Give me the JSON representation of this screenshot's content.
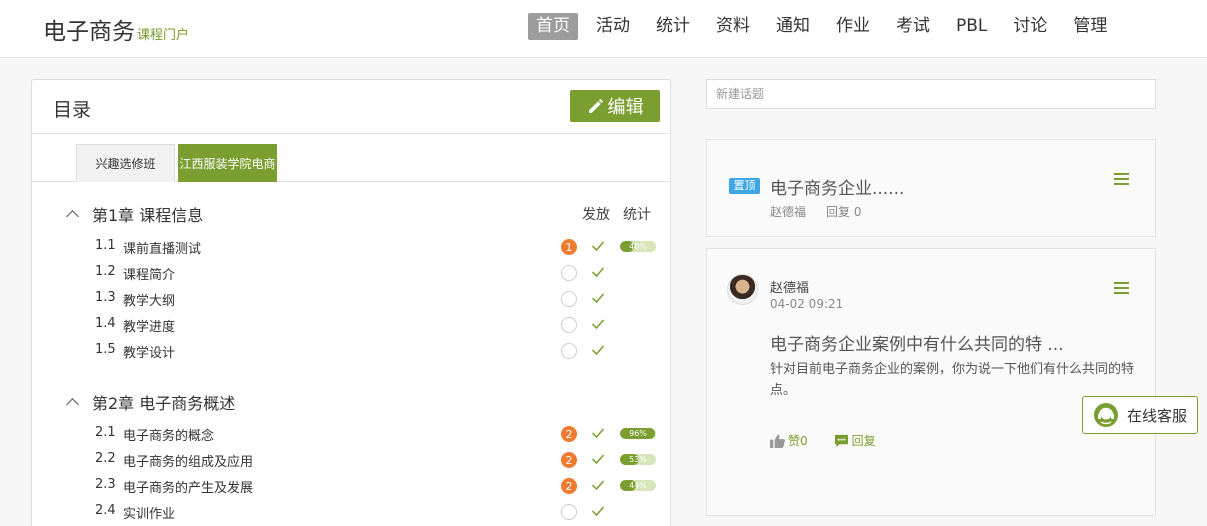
{
  "brand": {
    "title": "电子商务",
    "subtitle": "课程门户"
  },
  "nav": [
    "首页",
    "活动",
    "统计",
    "资料",
    "通知",
    "作业",
    "考试",
    "PBL",
    "讨论",
    "管理"
  ],
  "catalog": {
    "title": "目录",
    "edit_label": "编辑",
    "tabs": [
      "兴趣选修班",
      "江西服装学院电商"
    ],
    "col_publish": "发放",
    "col_stats": "统计",
    "chapters": [
      {
        "title": "第1章 课程信息",
        "items": [
          {
            "num": "1.1",
            "label": "课前直播测试",
            "badge": "1",
            "progress": "40%"
          },
          {
            "num": "1.2",
            "label": "课程简介",
            "badge": "",
            "progress": ""
          },
          {
            "num": "1.3",
            "label": "教学大纲",
            "badge": "",
            "progress": ""
          },
          {
            "num": "1.4",
            "label": "教学进度",
            "badge": "",
            "progress": ""
          },
          {
            "num": "1.5",
            "label": "教学设计",
            "badge": "",
            "progress": ""
          }
        ]
      },
      {
        "title": "第2章 电子商务概述",
        "items": [
          {
            "num": "2.1",
            "label": "电子商务的概念",
            "badge": "2",
            "progress": "96%"
          },
          {
            "num": "2.2",
            "label": "电子商务的组成及应用",
            "badge": "2",
            "progress": "53%"
          },
          {
            "num": "2.3",
            "label": "电子商务的产生及发展",
            "badge": "2",
            "progress": "44%"
          },
          {
            "num": "2.4",
            "label": "实训作业",
            "badge": "",
            "progress": ""
          }
        ]
      }
    ]
  },
  "discussion": {
    "new_topic_placeholder": "新建话题",
    "pinned": {
      "tag": "置顶",
      "title": "电子商务企业......",
      "author": "赵德福",
      "reply": "回复 0"
    },
    "post": {
      "author": "赵德福",
      "time": "04-02 09:21",
      "title": "电子商务企业案例中有什么共同的特 ...",
      "body": "针对目前电子商务企业的案例，你为说一下他们有什么共同的特点。",
      "like": "赞0",
      "reply": "回复"
    }
  },
  "service_label": "在线客服",
  "colors": {
    "accent": "#7a9e2f",
    "badge": "#ef7a30",
    "pin": "#3ea6e4"
  }
}
